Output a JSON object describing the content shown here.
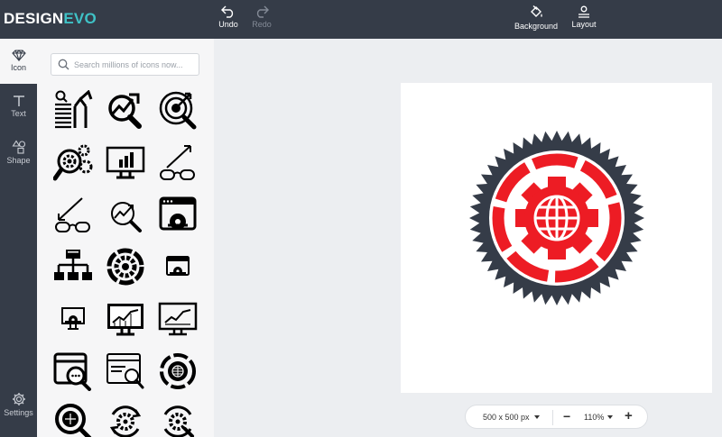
{
  "app": {
    "logo_part1": "DESIGN",
    "logo_part2": "EVO"
  },
  "toolbar": {
    "undo_label": "Undo",
    "redo_label": "Redo",
    "background_label": "Background",
    "layout_label": "Layout"
  },
  "sidebar": {
    "items": [
      {
        "label": "Icon",
        "icon": "diamond-icon"
      },
      {
        "label": "Text",
        "icon": "text-t-icon"
      },
      {
        "label": "Shape",
        "icon": "shapes-icon"
      }
    ],
    "settings_label": "Settings"
  },
  "search": {
    "placeholder": "Search millions of icons now..."
  },
  "icons": [
    "search-growth-arrow-icon",
    "magnifier-trend-icon",
    "target-magnifier-icon",
    "gear-search-icon",
    "monitor-bar-chart-icon",
    "glasses-rising-arrow-icon",
    "glasses-falling-arrow-icon",
    "magnifier-trend-outline-icon",
    "browser-gear-icon",
    "sitemap-icon",
    "gear-ring-icon",
    "browser-gear-small-icon",
    "monitor-gear-icon",
    "monitor-line-chart-icon",
    "monitor-line-chart-outline-icon",
    "browser-chat-search-icon",
    "browser-search-icon",
    "globe-gear-ring-icon",
    "globe-magnifier-icon",
    "gear-cycle-icon",
    "gear-cycle-search-icon"
  ],
  "canvas": {
    "logo_badge_icon": "globe-gear-badge-icon",
    "colors": {
      "badge": "#353c48",
      "accent": "#ed1c24"
    }
  },
  "zoombar": {
    "size_label": "500 x 500 px",
    "zoom_label": "110%",
    "minus": "−",
    "plus": "+"
  }
}
